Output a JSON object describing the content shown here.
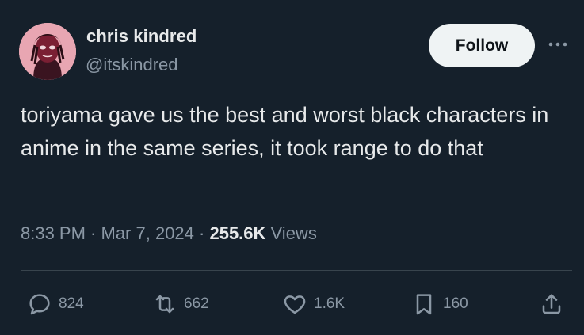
{
  "user": {
    "display_name": "chris kindred",
    "handle": "@itskindred"
  },
  "follow_label": "Follow",
  "tweet": {
    "text": "toriyama gave us the best and worst black characters in anime in the same series, it took range to do that"
  },
  "meta": {
    "time": "8:33 PM",
    "separator1": " · ",
    "date": "Mar 7, 2024",
    "separator2": " · ",
    "views_count": "255.6K",
    "views_label": " Views"
  },
  "actions": {
    "replies": "824",
    "reposts": "662",
    "likes": "1.6K",
    "bookmarks": "160"
  },
  "icons": [
    "avatar",
    "more-icon",
    "reply-icon",
    "repost-icon",
    "like-icon",
    "bookmark-icon",
    "share-icon"
  ],
  "colors": {
    "background": "#15202b",
    "text": "#e7e9ea",
    "secondary_text": "#8b98a5",
    "follow_button_bg": "#eff3f4",
    "divider": "#38444d"
  }
}
